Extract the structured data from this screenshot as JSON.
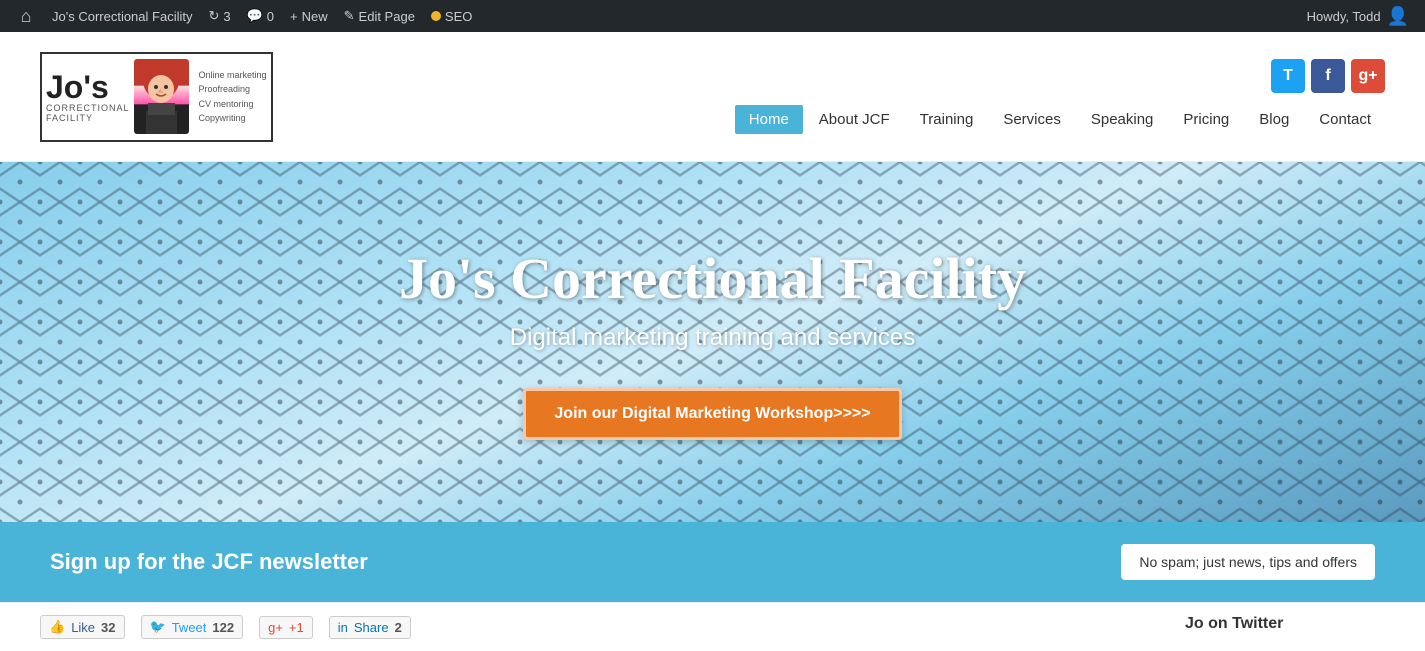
{
  "adminBar": {
    "siteName": "Jo's Correctional Facility",
    "updates": "3",
    "comments": "0",
    "newLabel": "New",
    "editLabel": "Edit Page",
    "seoLabel": "SEO",
    "howdy": "Howdy, Todd"
  },
  "header": {
    "logoJos": "Jo's",
    "logoCorrectional": "CORRECTIONAL",
    "logoFacility": "FACILITY",
    "tagline1": "Online marketing",
    "tagline2": "Proofreading",
    "tagline3": "CV mentoring",
    "tagline4": "Copywriting"
  },
  "nav": {
    "items": [
      {
        "label": "Home",
        "active": true
      },
      {
        "label": "About JCF",
        "active": false
      },
      {
        "label": "Training",
        "active": false
      },
      {
        "label": "Services",
        "active": false
      },
      {
        "label": "Speaking",
        "active": false
      },
      {
        "label": "Pricing",
        "active": false
      },
      {
        "label": "Blog",
        "active": false
      },
      {
        "label": "Contact",
        "active": false
      }
    ]
  },
  "social": {
    "twitter": "T",
    "facebook": "f",
    "gplus": "g+"
  },
  "hero": {
    "title": "Jo's Correctional Facility",
    "subtitle": "Digital marketing training and services",
    "ctaLabel": "Join our Digital Marketing Workshop>>>>"
  },
  "newsletter": {
    "text": "Sign up for the JCF newsletter",
    "badge": "No spam; just news, tips and offers"
  },
  "shareBar": {
    "fbLabel": "Like",
    "fbCount": "32",
    "twLabel": "Tweet",
    "twCount": "122",
    "gpLabel": "+1",
    "liLabel": "Share",
    "liCount": "2",
    "joTwitterLabel": "Jo on Twitter"
  }
}
